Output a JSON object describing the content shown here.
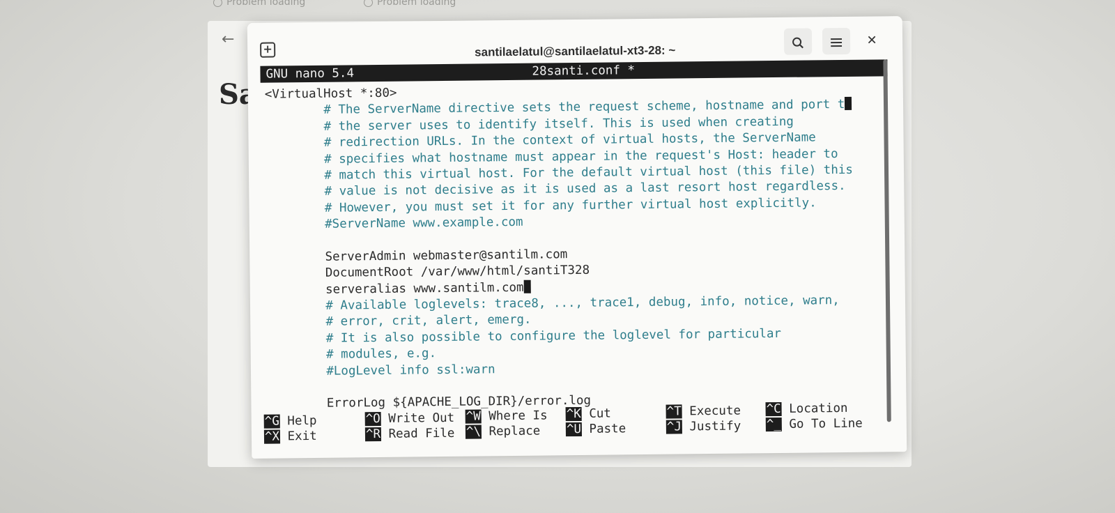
{
  "browser": {
    "tabs": [
      "Problem loading",
      "Problem loading"
    ],
    "page_heading": "Sa"
  },
  "window": {
    "title": "santilaelatul@santilaelatul-xt3-28: ~"
  },
  "nano": {
    "version_label": "GNU nano 5.4",
    "filename_label": "28santi.conf *",
    "lines": [
      {
        "text": "<VirtualHost *:80>",
        "type": "code"
      },
      {
        "text": "        # The ServerName directive sets the request scheme, hostname and port t",
        "type": "comment",
        "overflow": true
      },
      {
        "text": "        # the server uses to identify itself. This is used when creating",
        "type": "comment"
      },
      {
        "text": "        # redirection URLs. In the context of virtual hosts, the ServerName",
        "type": "comment"
      },
      {
        "text": "        # specifies what hostname must appear in the request's Host: header to",
        "type": "comment"
      },
      {
        "text": "        # match this virtual host. For the default virtual host (this file) this",
        "type": "comment"
      },
      {
        "text": "        # value is not decisive as it is used as a last resort host regardless.",
        "type": "comment"
      },
      {
        "text": "        # However, you must set it for any further virtual host explicitly.",
        "type": "comment"
      },
      {
        "text": "        #ServerName www.example.com",
        "type": "comment"
      },
      {
        "text": "",
        "type": "code"
      },
      {
        "text": "        ServerAdmin webmaster@santilm.com",
        "type": "code"
      },
      {
        "text": "        DocumentRoot /var/www/html/santiT328",
        "type": "code"
      },
      {
        "text": "        serveralias www.santilm.com",
        "type": "code",
        "cursor": true
      },
      {
        "text": "        # Available loglevels: trace8, ..., trace1, debug, info, notice, warn,",
        "type": "comment"
      },
      {
        "text": "        # error, crit, alert, emerg.",
        "type": "comment"
      },
      {
        "text": "        # It is also possible to configure the loglevel for particular",
        "type": "comment"
      },
      {
        "text": "        # modules, e.g.",
        "type": "comment"
      },
      {
        "text": "        #LogLevel info ssl:warn",
        "type": "comment"
      },
      {
        "text": "",
        "type": "code"
      },
      {
        "text": "        ErrorLog ${APACHE_LOG_DIR}/error.log",
        "type": "code"
      }
    ],
    "shortcuts": [
      {
        "key": "^G",
        "label": "Help"
      },
      {
        "key": "^X",
        "label": "Exit"
      },
      {
        "key": "^O",
        "label": "Write Out"
      },
      {
        "key": "^R",
        "label": "Read File"
      },
      {
        "key": "^W",
        "label": "Where Is"
      },
      {
        "key": "^\\",
        "label": "Replace"
      },
      {
        "key": "^K",
        "label": "Cut"
      },
      {
        "key": "^U",
        "label": "Paste"
      },
      {
        "key": "^T",
        "label": "Execute"
      },
      {
        "key": "^J",
        "label": "Justify"
      },
      {
        "key": "^C",
        "label": "Location"
      },
      {
        "key": "^_",
        "label": "Go To Line"
      }
    ]
  },
  "colors": {
    "comment": "#2f7e8c",
    "header_bg": "#1d1d1d",
    "terminal_bg": "#fafaf8"
  }
}
